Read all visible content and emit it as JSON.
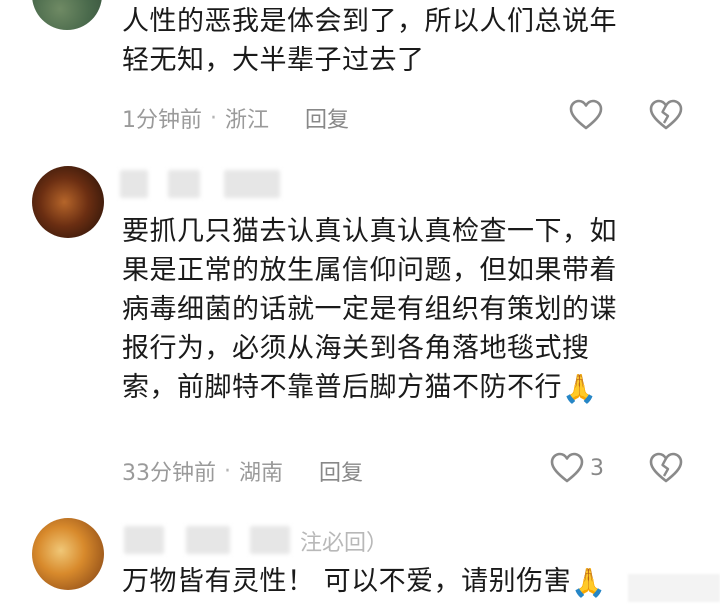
{
  "comments": [
    {
      "text": "人性的恶我是体会到了，所以人们总说年\n轻无知，大半辈子过去了",
      "time": "1分钟前",
      "location": "浙江",
      "reply_label": "回复",
      "likes": ""
    },
    {
      "text": "要抓几只猫去认真认真认真检查一下，如\n果是正常的放生属信仰问题，但如果带着\n病毒细菌的话就一定是有组织有策划的谍\n报行为，必须从海关到各角落地毯式搜\n索，前脚特不靠普后脚方猫不防不行",
      "emoji": "🙏",
      "time": "33分钟前",
      "location": "湖南",
      "reply_label": "回复",
      "likes": "3"
    },
    {
      "name_suffix": "注必回）",
      "text": "万物皆有灵性！ 可以不爱，请别伤害",
      "emoji": "🙏"
    }
  ],
  "separator": "·",
  "icons": {
    "like": "heart-outline-icon",
    "dislike": "broken-heart-icon"
  },
  "colors": {
    "text": "#1a1a1a",
    "meta": "#9a9a9a",
    "icon": "#8a8a8a",
    "emoji": "#f2b23b"
  }
}
